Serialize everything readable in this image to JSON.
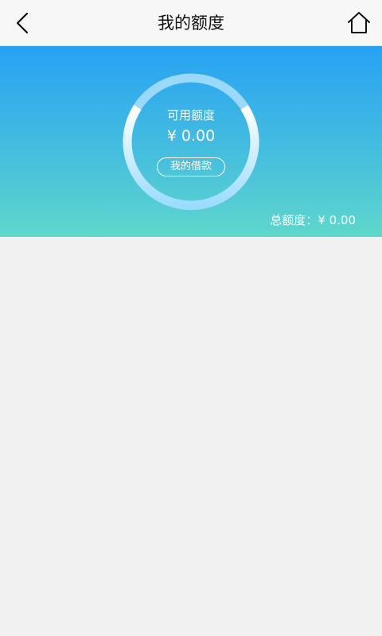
{
  "header": {
    "title": "我的额度",
    "back_icon": "chevron-left-icon",
    "home_icon": "home-icon"
  },
  "credit": {
    "available_label": "可用额度",
    "available_amount": "¥ 0.00",
    "my_loan_label": "我的借款",
    "total_label": "总额度：¥ 0.00"
  },
  "colors": {
    "banner_top": "#27a2f3",
    "banner_bottom": "#5fd7cc",
    "background": "#f1f1f1"
  }
}
